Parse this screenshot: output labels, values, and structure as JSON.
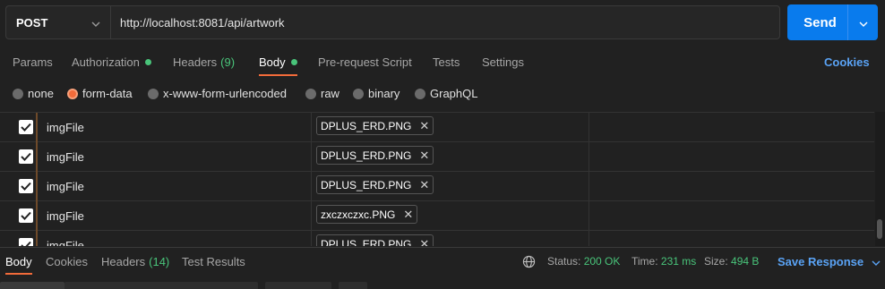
{
  "request": {
    "method": "POST",
    "url": "http://localhost:8081/api/artwork",
    "send_label": "Send"
  },
  "tabs": {
    "params": "Params",
    "authorization": "Authorization",
    "headers": "Headers",
    "headers_count": "(9)",
    "body": "Body",
    "prerequest": "Pre-request Script",
    "tests": "Tests",
    "settings": "Settings",
    "cookies": "Cookies"
  },
  "body_types": {
    "none": "none",
    "form_data": "form-data",
    "urlencoded": "x-www-form-urlencoded",
    "raw": "raw",
    "binary": "binary",
    "graphql": "GraphQL",
    "selected": "form-data"
  },
  "form_rows": [
    {
      "key": "imgFile",
      "file": "DPLUS_ERD.PNG",
      "checked": true
    },
    {
      "key": "imgFile",
      "file": "DPLUS_ERD.PNG",
      "checked": true
    },
    {
      "key": "imgFile",
      "file": "DPLUS_ERD.PNG",
      "checked": true
    },
    {
      "key": "imgFile",
      "file": "zxczxczxc.PNG",
      "checked": true
    },
    {
      "key": "imgFile",
      "file": "DPLUS_ERD.PNG",
      "checked": true
    }
  ],
  "response": {
    "tabs": {
      "body": "Body",
      "cookies": "Cookies",
      "headers": "Headers",
      "headers_count": "(14)",
      "test_results": "Test Results"
    },
    "status_label": "Status:",
    "status_value": "200 OK",
    "time_label": "Time:",
    "time_value": "231 ms",
    "size_label": "Size:",
    "size_value": "494 B",
    "save_label": "Save Response"
  },
  "colors": {
    "accent_orange": "#f26b3a",
    "send_blue": "#097bed",
    "success_green": "#49c47a",
    "link_blue": "#5aa3f5"
  },
  "icons": {
    "method_dropdown": "chevron-down-icon",
    "send_dropdown": "chevron-down-icon",
    "globe": "globe-icon",
    "checkbox": "check-icon",
    "remove_file": "close-icon"
  }
}
